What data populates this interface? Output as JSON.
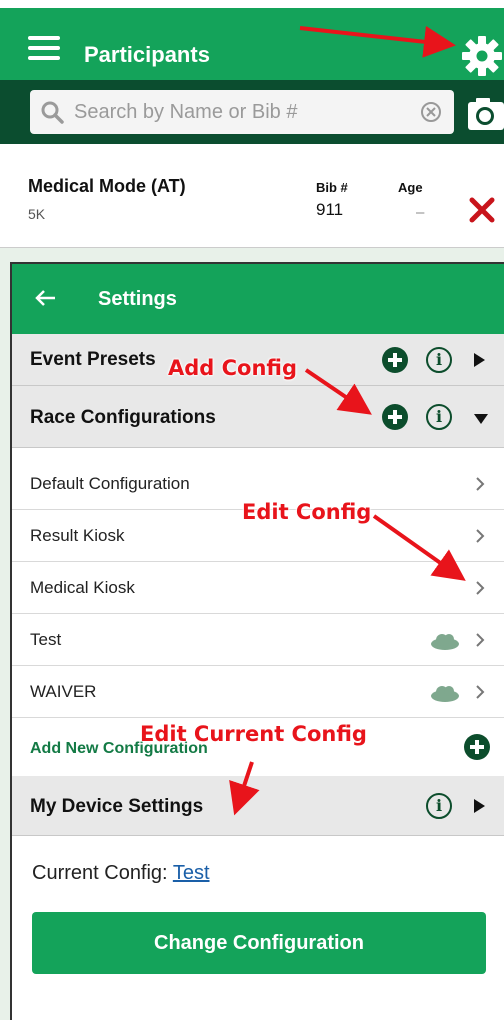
{
  "participants": {
    "title": "Participants",
    "search_placeholder": "Search by Name or Bib #",
    "row": {
      "name": "Medical Mode (AT)",
      "event": "5K",
      "bib_header": "Bib #",
      "bib": "911",
      "age_header": "Age",
      "age": "–"
    }
  },
  "settings": {
    "title": "Settings",
    "sections": {
      "event_presets": "Event Presets",
      "race_configurations": "Race Configurations",
      "my_device_settings": "My Device Settings"
    },
    "configs": [
      {
        "label": "Default Configuration",
        "cloud": false
      },
      {
        "label": "Result Kiosk",
        "cloud": false
      },
      {
        "label": "Medical Kiosk",
        "cloud": false
      },
      {
        "label": "Test",
        "cloud": true
      },
      {
        "label": "WAIVER",
        "cloud": true
      }
    ],
    "add_new_label": "Add New Configuration",
    "current_config_label": "Current Config:",
    "current_config_value": "Test",
    "change_button": "Change Configuration"
  },
  "annotations": {
    "add_config": "Add Config",
    "edit_config": "Edit Config",
    "edit_current_config": "Edit Current Config"
  },
  "colors": {
    "header_green": "#14a35a",
    "dark_green": "#0b4d2f",
    "annotation_red": "#e8141b",
    "delete_red": "#c8141b",
    "link_blue": "#1a5fa8",
    "cloud": "#7fa88e"
  },
  "icons": [
    "menu-icon",
    "gear-icon",
    "search-icon",
    "clear-icon",
    "camera-icon",
    "delete-icon",
    "back-arrow-icon",
    "plus-icon",
    "info-icon",
    "chevron-right-icon",
    "cloud-icon"
  ]
}
